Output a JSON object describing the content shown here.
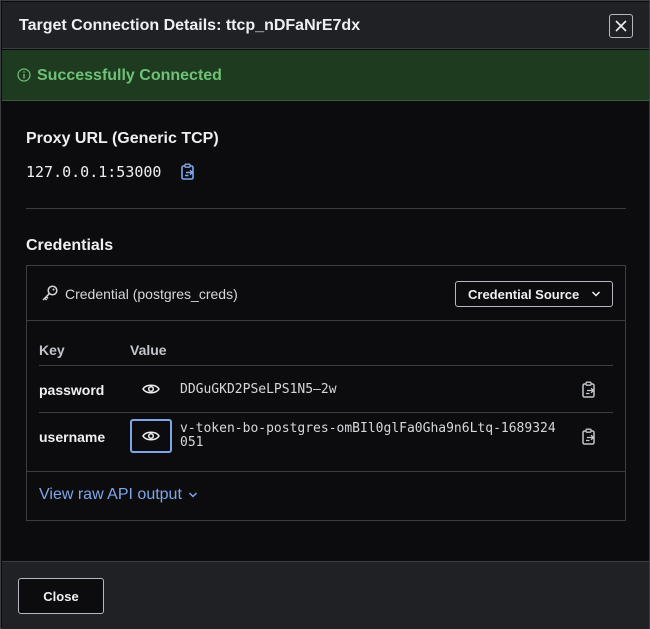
{
  "dialog": {
    "title": "Target Connection Details: ttcp_nDFaNrE7dx",
    "close_icon": "close-icon"
  },
  "banner": {
    "icon": "info-circle-icon",
    "text": "Successfully Connected",
    "color": "#6ec278"
  },
  "proxy": {
    "heading": "Proxy URL (Generic TCP)",
    "url": "127.0.0.1:53000",
    "copy_icon": "clipboard-icon"
  },
  "credentials": {
    "heading": "Credentials",
    "card": {
      "icon": "key-icon",
      "name": "Credential (postgres_creds)",
      "source_button": "Credential Source",
      "columns": [
        "Key",
        "Value"
      ],
      "rows": [
        {
          "key": "password",
          "value": "DDGuGKD2PSeLPS1N5–2w"
        },
        {
          "key": "username",
          "value": "v-token-bo-postgres-omBIl0glFa0Gha9n6Ltq-1689324051"
        }
      ],
      "raw_link": "View raw API output"
    }
  },
  "footer": {
    "close_button": "Close"
  },
  "colors": {
    "accent": "#7ea6e8",
    "success_bg": "#1e3b1f",
    "surface": "#0c0c0e",
    "header_bg": "#1f2124"
  }
}
